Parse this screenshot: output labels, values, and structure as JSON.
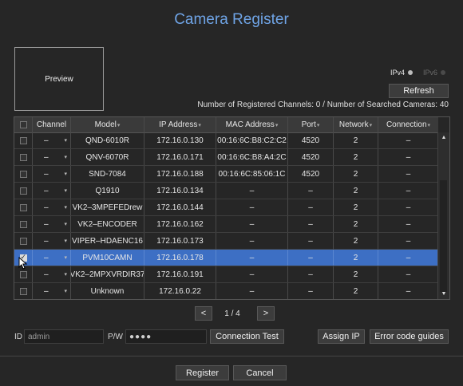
{
  "window": {
    "title": "Camera Register"
  },
  "preview": {
    "label": "Preview"
  },
  "ip_mode": {
    "ipv4_label": "IPv4",
    "ipv6_label": "IPv6",
    "selected": "IPv4"
  },
  "refresh_label": "Refresh",
  "status_text": "Number of Registered Channels: 0 / Number of Searched Cameras: 40",
  "table": {
    "headers": {
      "channel": "Channel",
      "model": "Model",
      "ip": "IP Address",
      "mac": "MAC Address",
      "port": "Port",
      "network": "Network",
      "connection": "Connection"
    },
    "rows": [
      {
        "checked": false,
        "channel": "–",
        "model": "QND-6010R",
        "ip": "172.16.0.130",
        "mac": "00:16:6C:B8:C2:C2",
        "port": "4520",
        "network": "2",
        "connection": "–"
      },
      {
        "checked": false,
        "channel": "–",
        "model": "QNV-6070R",
        "ip": "172.16.0.171",
        "mac": "00:16:6C:B8:A4:2C",
        "port": "4520",
        "network": "2",
        "connection": "–"
      },
      {
        "checked": false,
        "channel": "–",
        "model": "SND-7084",
        "ip": "172.16.0.188",
        "mac": "00:16:6C:85:06:1C",
        "port": "4520",
        "network": "2",
        "connection": "–"
      },
      {
        "checked": false,
        "channel": "–",
        "model": "Q1910",
        "ip": "172.16.0.134",
        "mac": "–",
        "port": "–",
        "network": "2",
        "connection": "–"
      },
      {
        "checked": false,
        "channel": "–",
        "model": "VK2–3MPEFEDrew",
        "ip": "172.16.0.144",
        "mac": "–",
        "port": "–",
        "network": "2",
        "connection": "–"
      },
      {
        "checked": false,
        "channel": "–",
        "model": "VK2–ENCODER",
        "ip": "172.16.0.162",
        "mac": "–",
        "port": "–",
        "network": "2",
        "connection": "–"
      },
      {
        "checked": false,
        "channel": "–",
        "model": "VIPER–HDAENC16",
        "ip": "172.16.0.173",
        "mac": "–",
        "port": "–",
        "network": "2",
        "connection": "–"
      },
      {
        "checked": true,
        "selected": true,
        "channel": "–",
        "model": "PVM10CAMN",
        "ip": "172.16.0.178",
        "mac": "–",
        "port": "–",
        "network": "2",
        "connection": "–"
      },
      {
        "checked": false,
        "channel": "–",
        "model": "VK2–2MPXVRDIR37",
        "ip": "172.16.0.191",
        "mac": "–",
        "port": "–",
        "network": "2",
        "connection": "–"
      },
      {
        "checked": false,
        "channel": "–",
        "model": "Unknown",
        "ip": "172.16.0.22",
        "mac": "–",
        "port": "–",
        "network": "2",
        "connection": "–"
      }
    ]
  },
  "pager": {
    "prev": "<",
    "next": ">",
    "text": "1 / 4"
  },
  "login": {
    "id_label": "ID",
    "id_value": "admin",
    "pw_label": "P/W",
    "pw_value": "●●●●"
  },
  "buttons": {
    "connection_test": "Connection Test",
    "assign_ip": "Assign IP",
    "error_guides": "Error code guides",
    "register": "Register",
    "cancel": "Cancel"
  },
  "colors": {
    "accent": "#6fa4e6",
    "selected_row": "#3d6fc4",
    "background": "#262626"
  }
}
